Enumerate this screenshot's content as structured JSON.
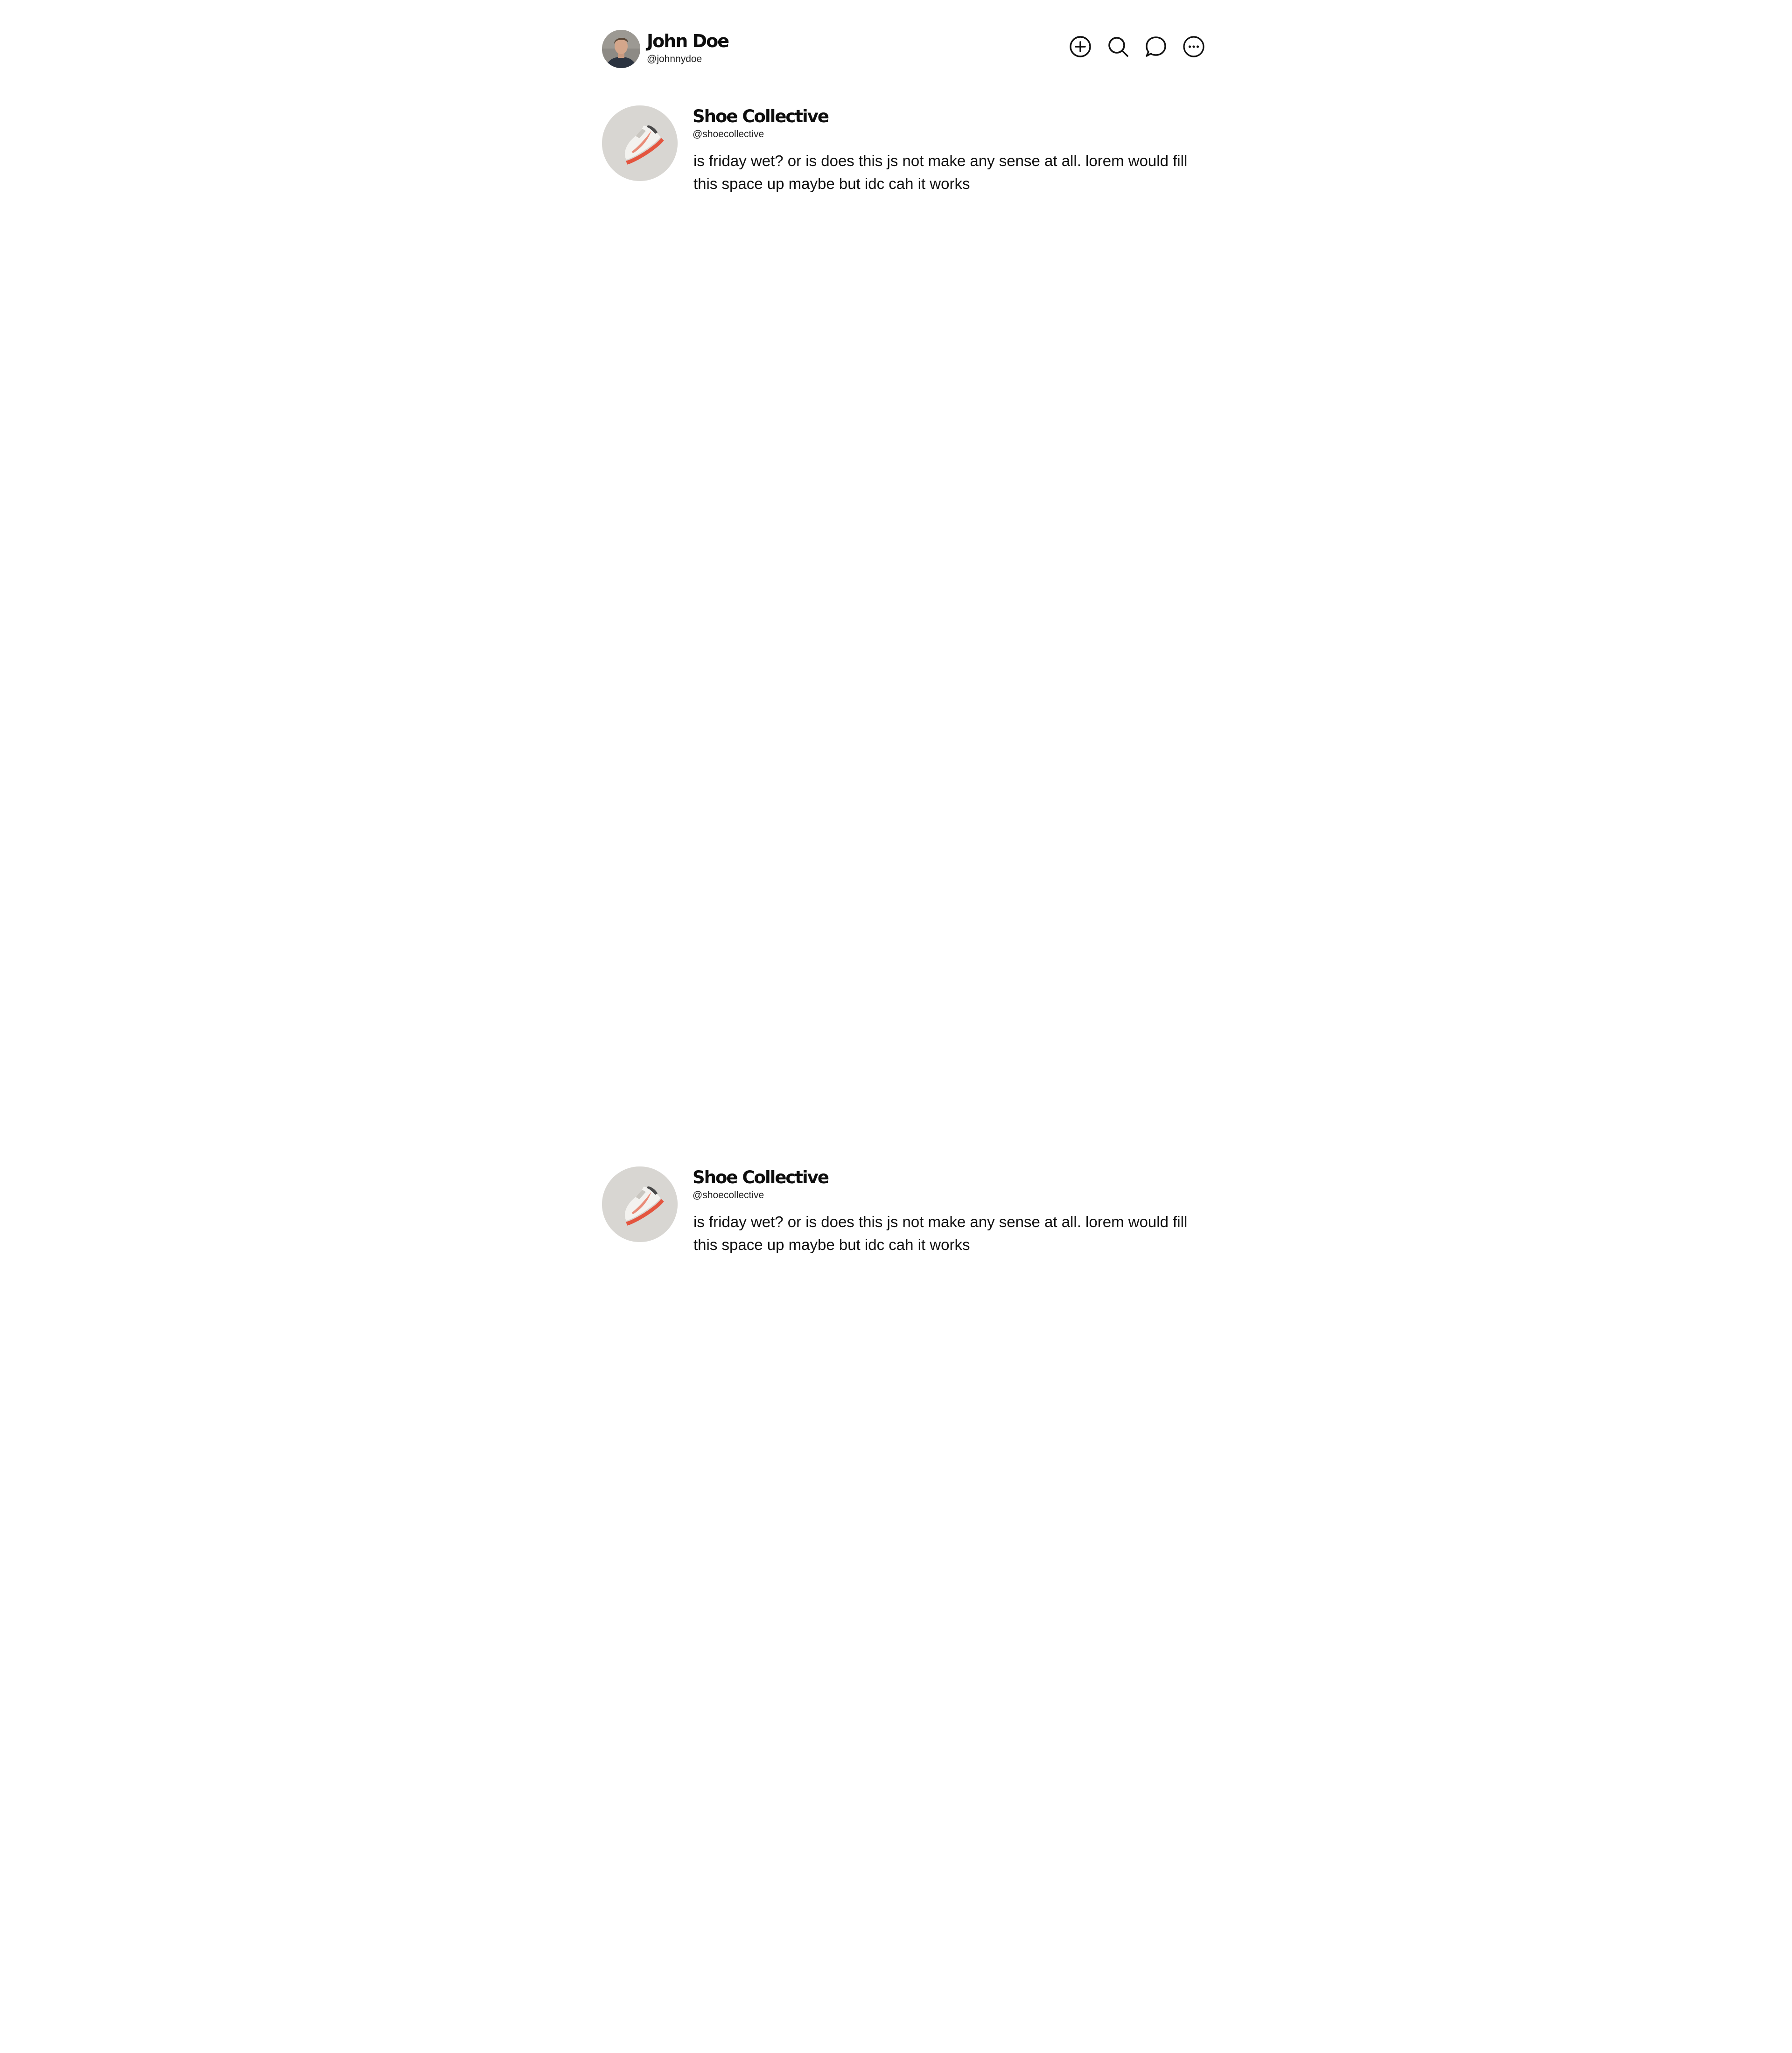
{
  "header": {
    "user_name": "John Doe",
    "user_handle": "@johnnydoe",
    "icons": [
      {
        "name": "plus-circle-icon",
        "label": "Create"
      },
      {
        "name": "search-icon",
        "label": "Search"
      },
      {
        "name": "chat-bubble-icon",
        "label": "Messages"
      },
      {
        "name": "more-circle-icon",
        "label": "More"
      }
    ]
  },
  "posts": [
    {
      "author": "Shoe Collective",
      "handle": "@shoecollective",
      "text": "is friday wet? or is does this js not make any sense at all. lorem would fill this space up maybe but idc cah it works",
      "avatar_icon": "sneaker-avatar"
    },
    {
      "author": "Shoe Collective",
      "handle": "@shoecollective",
      "text": "is friday wet? or is does this js not make any sense at all. lorem would fill this space up maybe but idc cah it works",
      "avatar_icon": "sneaker-avatar"
    }
  ],
  "colors": {
    "background": "#ffffff",
    "text": "#111111",
    "avatar_bg": "#d8d6d2",
    "sneaker_accent": "#e4553f"
  }
}
